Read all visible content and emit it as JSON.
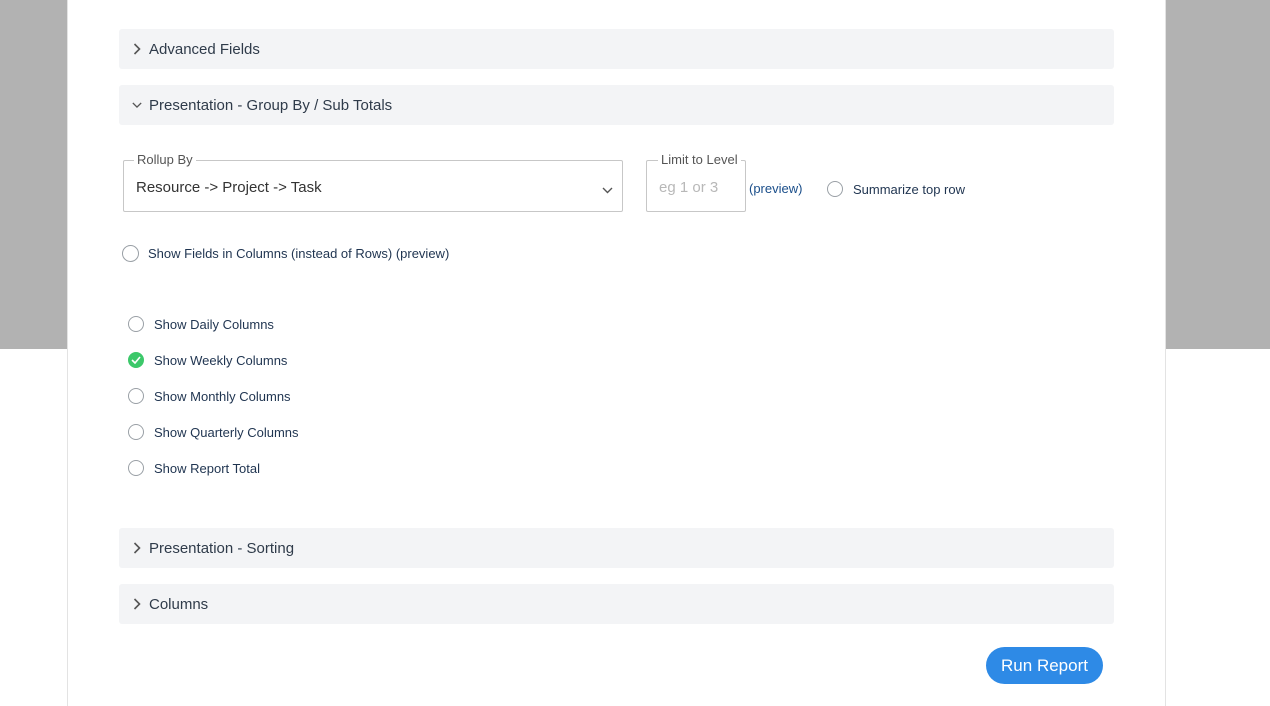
{
  "sections": {
    "advanced_fields": "Advanced Fields",
    "presentation_group": "Presentation - Group By / Sub Totals",
    "presentation_sorting": "Presentation - Sorting",
    "columns": "Columns"
  },
  "rollup": {
    "legend": "Rollup By",
    "value": "Resource -> Project -> Task"
  },
  "limit": {
    "legend": "Limit to Level",
    "placeholder": "eg 1 or 3",
    "preview_link": "(preview)"
  },
  "summarize_top_row": "Summarize top row",
  "show_fields_in_columns": "Show Fields in Columns (instead of Rows) (preview)",
  "column_options": [
    {
      "label": "Show Daily Columns",
      "checked": false
    },
    {
      "label": "Show Weekly Columns",
      "checked": true
    },
    {
      "label": "Show Monthly Columns",
      "checked": false
    },
    {
      "label": "Show Quarterly Columns",
      "checked": false
    },
    {
      "label": "Show Report Total",
      "checked": false
    }
  ],
  "run_button": "Run Report",
  "colors": {
    "accent": "#2e8ae6",
    "checked": "#3cc86a",
    "section_bg": "#f3f4f6"
  }
}
